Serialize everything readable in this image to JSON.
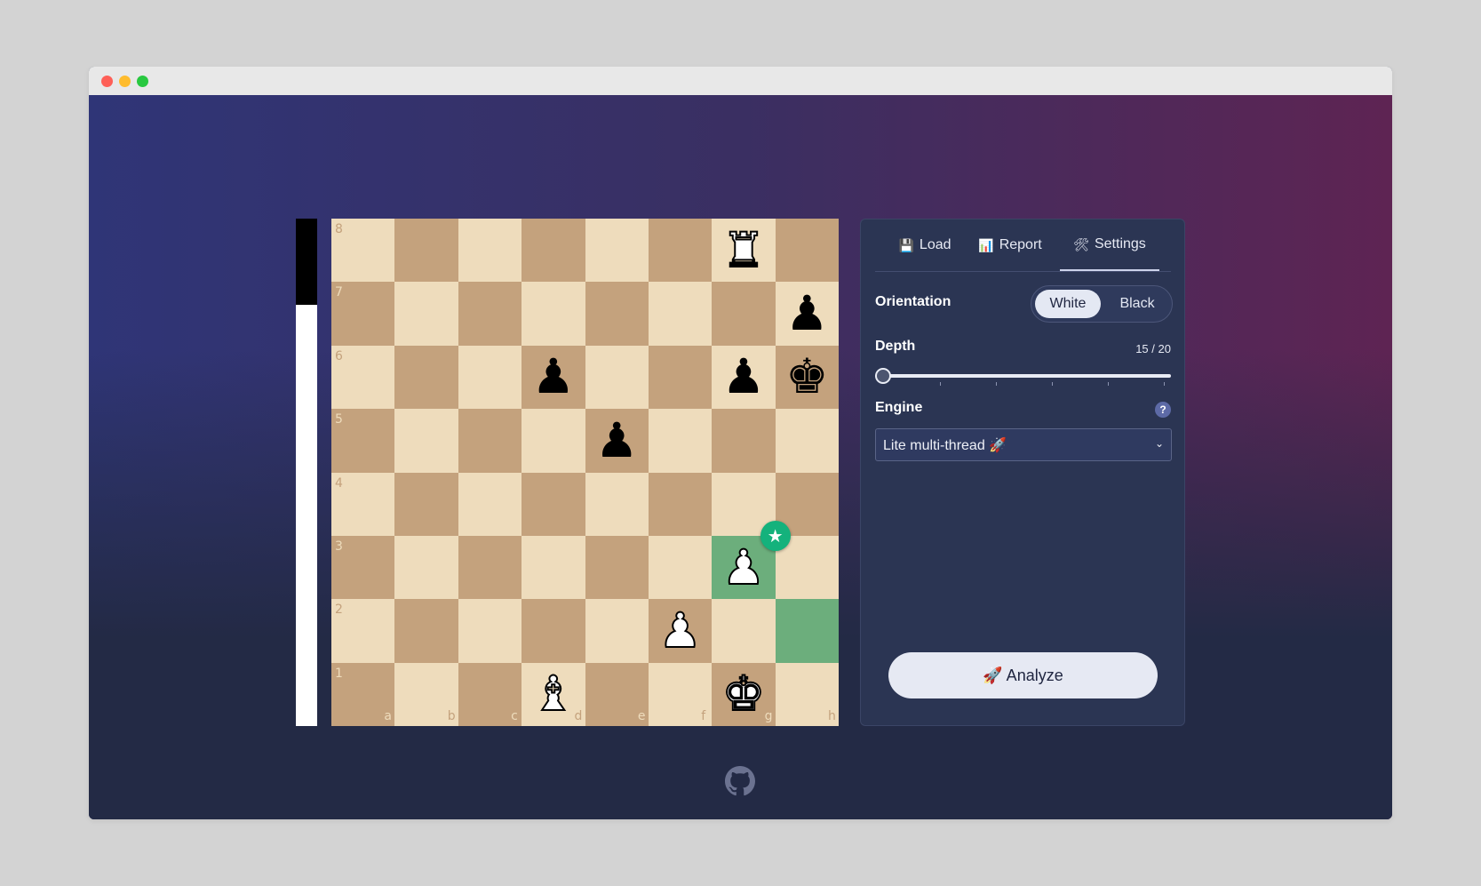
{
  "window": {
    "traffic_lights": [
      "#fe5f57",
      "#febc2e",
      "#28c840"
    ]
  },
  "theme": {
    "light_square": "#eedcbc",
    "dark_square": "#c4a27d",
    "highlight_light": "#6cae7c",
    "highlight_dark": "#6cae7c",
    "best_move_badge": "#14b27c"
  },
  "eval_bar": {
    "black_fraction": 0.17
  },
  "board": {
    "ranks": [
      "8",
      "7",
      "6",
      "5",
      "4",
      "3",
      "2",
      "1"
    ],
    "files": [
      "a",
      "b",
      "c",
      "d",
      "e",
      "f",
      "g",
      "h"
    ],
    "highlighted_squares": [
      "g3",
      "h2"
    ],
    "best_move_badge_square": "g3",
    "best_move_badge_icon": "star-icon",
    "pieces": [
      {
        "square": "g8",
        "color": "white",
        "type": "rook",
        "glyph": "♜"
      },
      {
        "square": "h7",
        "color": "black",
        "type": "pawn",
        "glyph": "♟"
      },
      {
        "square": "d6",
        "color": "black",
        "type": "pawn",
        "glyph": "♟"
      },
      {
        "square": "g6",
        "color": "black",
        "type": "pawn",
        "glyph": "♟"
      },
      {
        "square": "h6",
        "color": "black",
        "type": "king",
        "glyph": "♚"
      },
      {
        "square": "e5",
        "color": "black",
        "type": "pawn",
        "glyph": "♟"
      },
      {
        "square": "g3",
        "color": "white",
        "type": "pawn",
        "glyph": "♟"
      },
      {
        "square": "f2",
        "color": "white",
        "type": "pawn",
        "glyph": "♟"
      },
      {
        "square": "d1",
        "color": "white",
        "type": "bishop",
        "glyph": "♝"
      },
      {
        "square": "g1",
        "color": "white",
        "type": "king",
        "glyph": "♚"
      }
    ]
  },
  "panel": {
    "tabs": [
      {
        "icon": "💾",
        "icon_name": "floppy-disk-icon",
        "label": "Load",
        "active": false
      },
      {
        "icon": "📊",
        "icon_name": "bar-chart-icon",
        "label": "Report",
        "active": false
      },
      {
        "icon": "🛠",
        "icon_name": "tools-icon",
        "label": "Settings",
        "active": true
      }
    ],
    "orientation": {
      "label": "Orientation",
      "options": [
        "White",
        "Black"
      ],
      "selected": "White"
    },
    "depth": {
      "label": "Depth",
      "value": "15",
      "max": "20",
      "separator": "/",
      "fraction": 0.0
    },
    "engine": {
      "label": "Engine",
      "help": "?",
      "selected": "Lite multi-thread 🚀"
    },
    "analyze_button": "🚀 Analyze"
  },
  "footer": {
    "icon": "github-icon"
  }
}
